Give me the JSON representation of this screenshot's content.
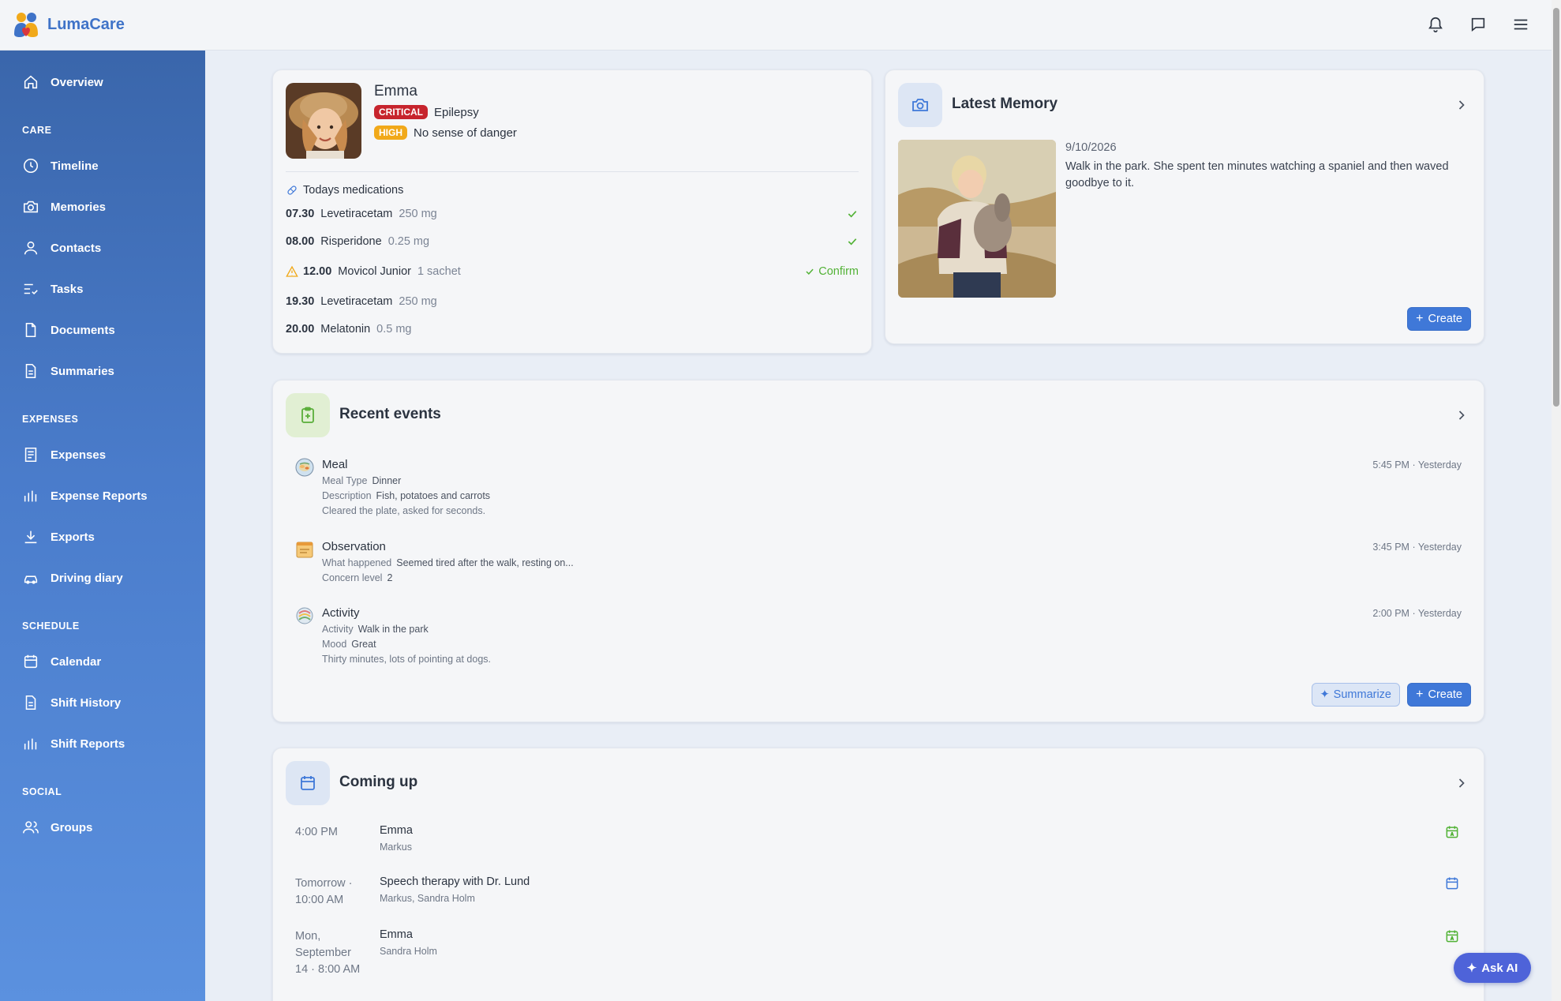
{
  "app": {
    "name": "LumaCare"
  },
  "topbar": {
    "icons": [
      "bell-icon",
      "chat-icon",
      "menu-icon"
    ]
  },
  "sidebar": {
    "overview": "Overview",
    "sections": {
      "care": "CARE",
      "expenses": "EXPENSES",
      "schedule": "SCHEDULE",
      "social": "SOCIAL"
    },
    "care_items": [
      "Timeline",
      "Memories",
      "Contacts",
      "Tasks",
      "Documents",
      "Summaries"
    ],
    "expense_items": [
      "Expenses",
      "Expense Reports",
      "Exports",
      "Driving diary"
    ],
    "schedule_items": [
      "Calendar",
      "Shift History",
      "Shift Reports"
    ],
    "social_items": [
      "Groups"
    ]
  },
  "profile": {
    "name": "Emma",
    "conditions": [
      {
        "badge": "CRITICAL",
        "label": "Epilepsy"
      },
      {
        "badge": "HIGH",
        "label": "No sense of danger"
      }
    ],
    "medications_title": "Todays medications",
    "medications": [
      {
        "time": "07.30",
        "name": "Levetiracetam",
        "dose": "250 mg",
        "status": "done"
      },
      {
        "time": "08.00",
        "name": "Risperidone",
        "dose": "0.25 mg",
        "status": "done"
      },
      {
        "time": "12.00",
        "name": "Movicol Junior",
        "dose": "1 sachet",
        "status": "warning",
        "action": "Confirm"
      },
      {
        "time": "19.30",
        "name": "Levetiracetam",
        "dose": "250 mg",
        "status": "pending"
      },
      {
        "time": "20.00",
        "name": "Melatonin",
        "dose": "0.5 mg",
        "status": "pending"
      }
    ]
  },
  "memory": {
    "title": "Latest Memory",
    "date": "9/10/2026",
    "text": "Walk in the park. She spent ten minutes watching a spaniel and then waved goodbye to it.",
    "create": "Create"
  },
  "events": {
    "title": "Recent events",
    "items": [
      {
        "title": "Meal",
        "time": "5:45 PM · Yesterday",
        "fields": [
          {
            "label": "Meal Type",
            "value": "Dinner"
          },
          {
            "label": "Description",
            "value": "Fish, potatoes and carrots"
          }
        ],
        "note": "Cleared the plate, asked for seconds."
      },
      {
        "title": "Observation",
        "time": "3:45 PM · Yesterday",
        "fields": [
          {
            "label": "What happened",
            "value": "Seemed tired after the walk, resting on..."
          },
          {
            "label": "Concern level",
            "value": "2"
          }
        ],
        "note": ""
      },
      {
        "title": "Activity",
        "time": "2:00 PM · Yesterday",
        "fields": [
          {
            "label": "Activity",
            "value": "Walk in the park"
          },
          {
            "label": "Mood",
            "value": "Great"
          }
        ],
        "note": "Thirty minutes, lots of pointing at dogs."
      }
    ],
    "summarize": "Summarize",
    "create": "Create"
  },
  "coming_up": {
    "title": "Coming up",
    "items": [
      {
        "when": "4:00 PM",
        "title": "Emma",
        "sub": "Markus",
        "icon": "shift-calendar-icon"
      },
      {
        "when": "Tomorrow · 10:00 AM",
        "title": "Speech therapy with Dr. Lund",
        "sub": "Markus, Sandra Holm",
        "icon": "calendar-icon"
      },
      {
        "when": "Mon, September 14 · 8:00 AM",
        "title": "Emma",
        "sub": "Sandra Holm",
        "icon": "shift-calendar-icon"
      }
    ]
  },
  "ask_ai": "Ask AI",
  "colors": {
    "brand": "#3f73c8",
    "primary_button": "#3f78d8",
    "critical": "#c7242d",
    "high": "#f1a91a",
    "success": "#52b236",
    "ask_ai": "#4e63d9"
  }
}
